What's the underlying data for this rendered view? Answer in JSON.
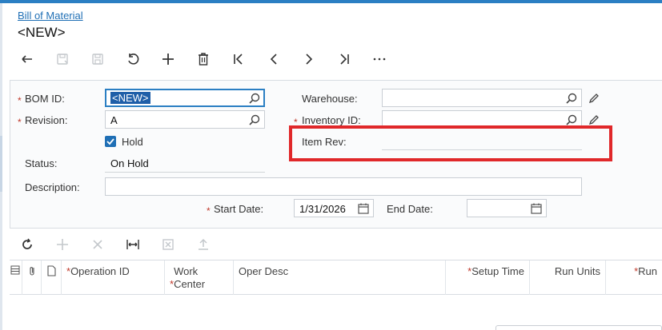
{
  "breadcrumb": "Bill of Material",
  "title": "<NEW>",
  "toolbar": {
    "icons": [
      "back-icon",
      "save-close-icon",
      "save-icon",
      "undo-icon",
      "add-icon",
      "delete-icon",
      "first-icon",
      "previous-icon",
      "next-icon",
      "last-icon",
      "more-icon"
    ],
    "more_label": "⋯"
  },
  "form": {
    "bom_id_label": "BOM ID:",
    "bom_id_value": "<NEW>",
    "revision_label": "Revision:",
    "revision_value": "A",
    "hold_label": "Hold",
    "hold_checked": true,
    "status_label": "Status:",
    "status_value": "On Hold",
    "description_label": "Description:",
    "description_value": "",
    "warehouse_label": "Warehouse:",
    "warehouse_value": "",
    "inventory_id_label": "Inventory ID:",
    "inventory_id_value": "",
    "item_rev_label": "Item Rev:",
    "item_rev_value": "",
    "start_date_label": "Start Date:",
    "start_date_value": "1/31/2026",
    "end_date_label": "End Date:",
    "end_date_value": "",
    "required_marker": "*"
  },
  "grid": {
    "toolbar_icons": [
      "refresh-icon",
      "add-row-icon",
      "delete-row-icon",
      "fit-columns-icon",
      "export-excel-icon",
      "upload-icon"
    ],
    "columns": [
      {
        "label": "Operation ID",
        "required": true
      },
      {
        "label": "Work Center",
        "required": true
      },
      {
        "label": "Oper Desc",
        "required": false
      },
      {
        "label": "Setup Time",
        "required": true
      },
      {
        "label": "Run Units",
        "required": false
      },
      {
        "label": "Run",
        "required": true
      }
    ]
  },
  "colors": {
    "accent": "#2b7fc3",
    "link": "#1f6fb5",
    "required": "#c0392b",
    "highlight_box": "#e0282a"
  }
}
